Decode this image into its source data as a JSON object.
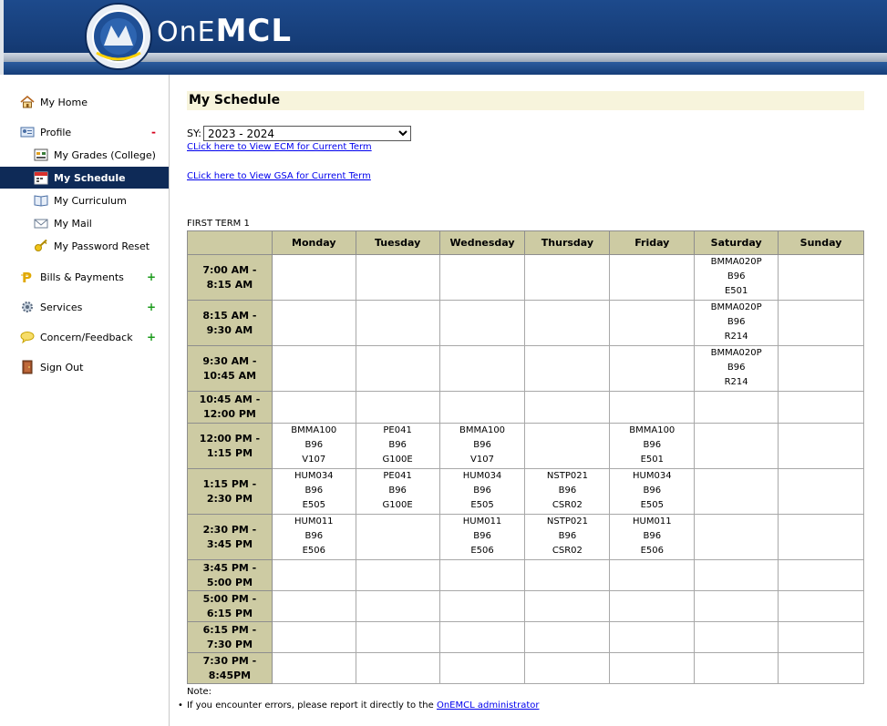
{
  "header": {
    "logo_prefix": "OnE",
    "logo_main": "MCL"
  },
  "sidebar": {
    "items": [
      {
        "label": "My Home",
        "icon": "home-icon"
      },
      {
        "label": "Profile",
        "icon": "profile-card-icon",
        "toggle": "-"
      },
      {
        "label": "My Grades (College)",
        "icon": "grades-icon"
      },
      {
        "label": "My Schedule",
        "icon": "calendar-icon"
      },
      {
        "label": "My Curriculum",
        "icon": "book-icon"
      },
      {
        "label": "My Mail",
        "icon": "mail-icon"
      },
      {
        "label": "My Password Reset",
        "icon": "key-icon"
      },
      {
        "label": "Bills & Payments",
        "icon": "peso-icon",
        "toggle": "+"
      },
      {
        "label": "Services",
        "icon": "services-gear-icon",
        "toggle": "+"
      },
      {
        "label": "Concern/Feedback",
        "icon": "speech-bubble-icon",
        "toggle": "+"
      },
      {
        "label": "Sign Out",
        "icon": "door-icon"
      }
    ]
  },
  "main": {
    "title": "My Schedule",
    "sy_label": "SY:",
    "sy_value": "2023 - 2024",
    "link_ecm": "CLick here to View ECM for Current Term",
    "link_gsa": "CLick here to View GSA for Current Term",
    "term_label": "FIRST TERM 1",
    "note_label": "Note:",
    "note_text": "If you encounter errors, please report it directly to the ",
    "note_link": "OnEMCL administrator"
  },
  "schedule": {
    "days": [
      "Monday",
      "Tuesday",
      "Wednesday",
      "Thursday",
      "Friday",
      "Saturday",
      "Sunday"
    ],
    "rows": [
      {
        "time": [
          "7:00 AM -",
          "8:15 AM"
        ],
        "cells": [
          null,
          null,
          null,
          null,
          null,
          [
            "BMMA020P",
            "B96",
            "E501"
          ],
          null
        ]
      },
      {
        "time": [
          "8:15 AM -",
          "9:30 AM"
        ],
        "cells": [
          null,
          null,
          null,
          null,
          null,
          [
            "BMMA020P",
            "B96",
            "R214"
          ],
          null
        ]
      },
      {
        "time": [
          "9:30 AM -",
          "10:45 AM"
        ],
        "cells": [
          null,
          null,
          null,
          null,
          null,
          [
            "BMMA020P",
            "B96",
            "R214"
          ],
          null
        ]
      },
      {
        "time": [
          "10:45 AM -",
          "12:00 PM"
        ],
        "cells": [
          null,
          null,
          null,
          null,
          null,
          null,
          null
        ]
      },
      {
        "time": [
          "12:00 PM -",
          "1:15 PM"
        ],
        "cells": [
          [
            "BMMA100",
            "B96",
            "V107"
          ],
          [
            "PE041",
            "B96",
            "G100E"
          ],
          [
            "BMMA100",
            "B96",
            "V107"
          ],
          null,
          [
            "BMMA100",
            "B96",
            "E501"
          ],
          null,
          null
        ]
      },
      {
        "time": [
          "1:15 PM -",
          "2:30 PM"
        ],
        "cells": [
          [
            "HUM034",
            "B96",
            "E505"
          ],
          [
            "PE041",
            "B96",
            "G100E"
          ],
          [
            "HUM034",
            "B96",
            "E505"
          ],
          [
            "NSTP021",
            "B96",
            "CSR02"
          ],
          [
            "HUM034",
            "B96",
            "E505"
          ],
          null,
          null
        ]
      },
      {
        "time": [
          "2:30 PM -",
          "3:45 PM"
        ],
        "cells": [
          [
            "HUM011",
            "B96",
            "E506"
          ],
          null,
          [
            "HUM011",
            "B96",
            "E506"
          ],
          [
            "NSTP021",
            "B96",
            "CSR02"
          ],
          [
            "HUM011",
            "B96",
            "E506"
          ],
          null,
          null
        ]
      },
      {
        "time": [
          "3:45 PM -",
          "5:00 PM"
        ],
        "cells": [
          null,
          null,
          null,
          null,
          null,
          null,
          null
        ]
      },
      {
        "time": [
          "5:00 PM -",
          "6:15 PM"
        ],
        "cells": [
          null,
          null,
          null,
          null,
          null,
          null,
          null
        ]
      },
      {
        "time": [
          "6:15 PM -",
          "7:30 PM"
        ],
        "cells": [
          null,
          null,
          null,
          null,
          null,
          null,
          null
        ]
      },
      {
        "time": [
          "7:30 PM -",
          "8:45PM"
        ],
        "cells": [
          null,
          null,
          null,
          null,
          null,
          null,
          null
        ]
      }
    ]
  }
}
